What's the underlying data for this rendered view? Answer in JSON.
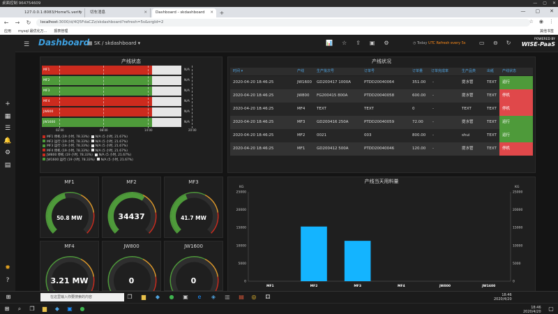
{
  "remote": {
    "title": "桌面控制 964754609",
    "controls": [
      "—",
      "▢",
      "✕"
    ]
  },
  "browser": {
    "tabs": [
      {
        "label": "127.0.0.1:8083/Home%.verify",
        "active": false
      },
      {
        "label": "切车消息",
        "active": false
      },
      {
        "label": "Dashboard - skdashboard",
        "active": true
      }
    ],
    "url_host": "localhost",
    "url_path": ":3000/d/4Q5FdaCZz/skdashboard?refresh=5s&orgId=2",
    "bookmarks": [
      "应用",
      "mysql 最优化万...",
      "报表管理"
    ],
    "bookmarks_right": "其他书签"
  },
  "app": {
    "logo": "Dashboard",
    "dashboard_path": "SK / skdashboard ▾",
    "time_label": "Today",
    "time_zone": "UTC",
    "refresh_label": "Refresh every 5s",
    "powered_by": "POWERED BY",
    "powered_brand": "WISE-PaaS"
  },
  "status_panel": {
    "title": "产线状态",
    "rows": [
      {
        "name": "MF1",
        "color": "#cc2b1e",
        "run_fraction": 0.789,
        "na": "N/A"
      },
      {
        "name": "MF2",
        "color": "#4e9a3a",
        "run_fraction": 0.789,
        "na": "N/A"
      },
      {
        "name": "MF3",
        "color": "#4e9a3a",
        "run_fraction": 0.789,
        "na": "N/A"
      },
      {
        "name": "MF4",
        "color": "#cc2b1e",
        "run_fraction": 0.789,
        "na": "N/A"
      },
      {
        "name": "JW800",
        "color": "#cc2b1e",
        "run_fraction": 0.789,
        "na": "N/A"
      },
      {
        "name": "JW1600",
        "color": "#4e9a3a",
        "run_fraction": 0.789,
        "na": "N/A"
      }
    ],
    "xticks": [
      "02:00",
      "08:00",
      "14:00",
      "20:00"
    ],
    "legend": [
      {
        "left": "MF1 停机 (19 小时, 78.33%)",
        "left_color": "#cc2b1e",
        "right": "N/A (5 小时, 21.67%)"
      },
      {
        "left": "MF2 运行 (19 小时, 78.33%)",
        "left_color": "#4e9a3a",
        "right": "N/A (5 小时, 21.67%)"
      },
      {
        "left": "MF3 运行 (19 小时, 78.33%)",
        "left_color": "#4e9a3a",
        "right": "N/A (5 小时, 21.67%)"
      },
      {
        "left": "MF4 停机 (19 小时, 78.33%)",
        "left_color": "#cc2b1e",
        "right": "N/A (5 小时, 21.67%)"
      },
      {
        "left": "JW800 停机 (19 小时, 78.33%)",
        "left_color": "#cc2b1e",
        "right": "N/A (5 小时, 21.67%)"
      },
      {
        "left": "JW1600 运行 (19 小时, 78.33%)",
        "left_color": "#4e9a3a",
        "right": "N/A (5 小时, 21.67%)"
      }
    ]
  },
  "table_panel": {
    "title": "产线状况",
    "headers": [
      "时间 ▾",
      "产线",
      "生产批次号",
      "订单号",
      "订单量",
      "订单完成率",
      "生产品类",
      "出纸",
      "产线状态"
    ],
    "rows": [
      {
        "time": "2020-04-20 18:46:25",
        "line": "JW1600",
        "batch": "GD200417 1000A",
        "order": "PTDD20040064",
        "qty": "351.00",
        "rate": "-",
        "product": "提水管",
        "out": "TEXT",
        "status": "运行",
        "status_color": "#4e9a3a"
      },
      {
        "time": "2020-04-20 18:46:25",
        "line": "JW800",
        "batch": "FG200415 800A",
        "order": "PTDD20040058",
        "qty": "600.00",
        "rate": "-",
        "product": "提水管",
        "out": "TEXT",
        "status": "停机",
        "status_color": "#e0484a"
      },
      {
        "time": "2020-04-20 18:46:25",
        "line": "MF4",
        "batch": "TEXT",
        "order": "TEXT",
        "qty": "0",
        "rate": "-",
        "product": "TEXT",
        "out": "TEXT",
        "status": "停机",
        "status_color": "#e0484a"
      },
      {
        "time": "2020-04-20 18:46:25",
        "line": "MF3",
        "batch": "GD200416 250A",
        "order": "PTDD20040059",
        "qty": "72.00",
        "rate": "-",
        "product": "提水管",
        "out": "TEXT",
        "status": "运行",
        "status_color": "#4e9a3a"
      },
      {
        "time": "2020-04-20 18:46:25",
        "line": "MF2",
        "batch": "0021",
        "order": "003",
        "qty": "800.00",
        "rate": "-",
        "product": "shui",
        "out": "TEXT",
        "status": "运行",
        "status_color": "#4e9a3a"
      },
      {
        "time": "2020-04-20 18:46:25",
        "line": "MF1",
        "batch": "GD200412 500A",
        "order": "PTDD20040046",
        "qty": "120.00",
        "rate": "-",
        "product": "提水管",
        "out": "TEXT",
        "status": "停机",
        "status_color": "#e0484a"
      }
    ]
  },
  "gauges": [
    {
      "name": "MF1",
      "value": "50.8 MW",
      "fraction": 0.45,
      "big": false
    },
    {
      "name": "MF2",
      "value": "34437",
      "fraction": 0.62,
      "big": true
    },
    {
      "name": "MF3",
      "value": "41.7 MW",
      "fraction": 0.42,
      "big": false
    },
    {
      "name": "MF4",
      "value": "3.21 MW",
      "fraction": 0.05,
      "big": true
    },
    {
      "name": "JW800",
      "value": "0",
      "fraction": 0.0,
      "big": true
    },
    {
      "name": "JW1600",
      "value": "0",
      "fraction": 0.0,
      "big": true
    }
  ],
  "chart_data": {
    "type": "bar",
    "title": "产线当天用料量",
    "ylabel_left": "KG",
    "ylabel_right": "KG",
    "categories": [
      "MF1",
      "MF2",
      "MF3",
      "MF4",
      "JW800",
      "JW1600"
    ],
    "values": [
      0,
      15300,
      11300,
      0,
      0,
      0
    ],
    "ylim": [
      0,
      25000
    ],
    "yticks": [
      0,
      5000,
      10000,
      15000,
      20000,
      25000
    ],
    "bar_color": "#14b4ff",
    "grid": false
  },
  "taskbar": {
    "search_placeholder": "在这里输入你要搜索的内容",
    "clock_time_upper": "18:46",
    "clock_date_upper": "2020/4/20",
    "clock_time": "18:46",
    "clock_date": "2020/4/20"
  }
}
